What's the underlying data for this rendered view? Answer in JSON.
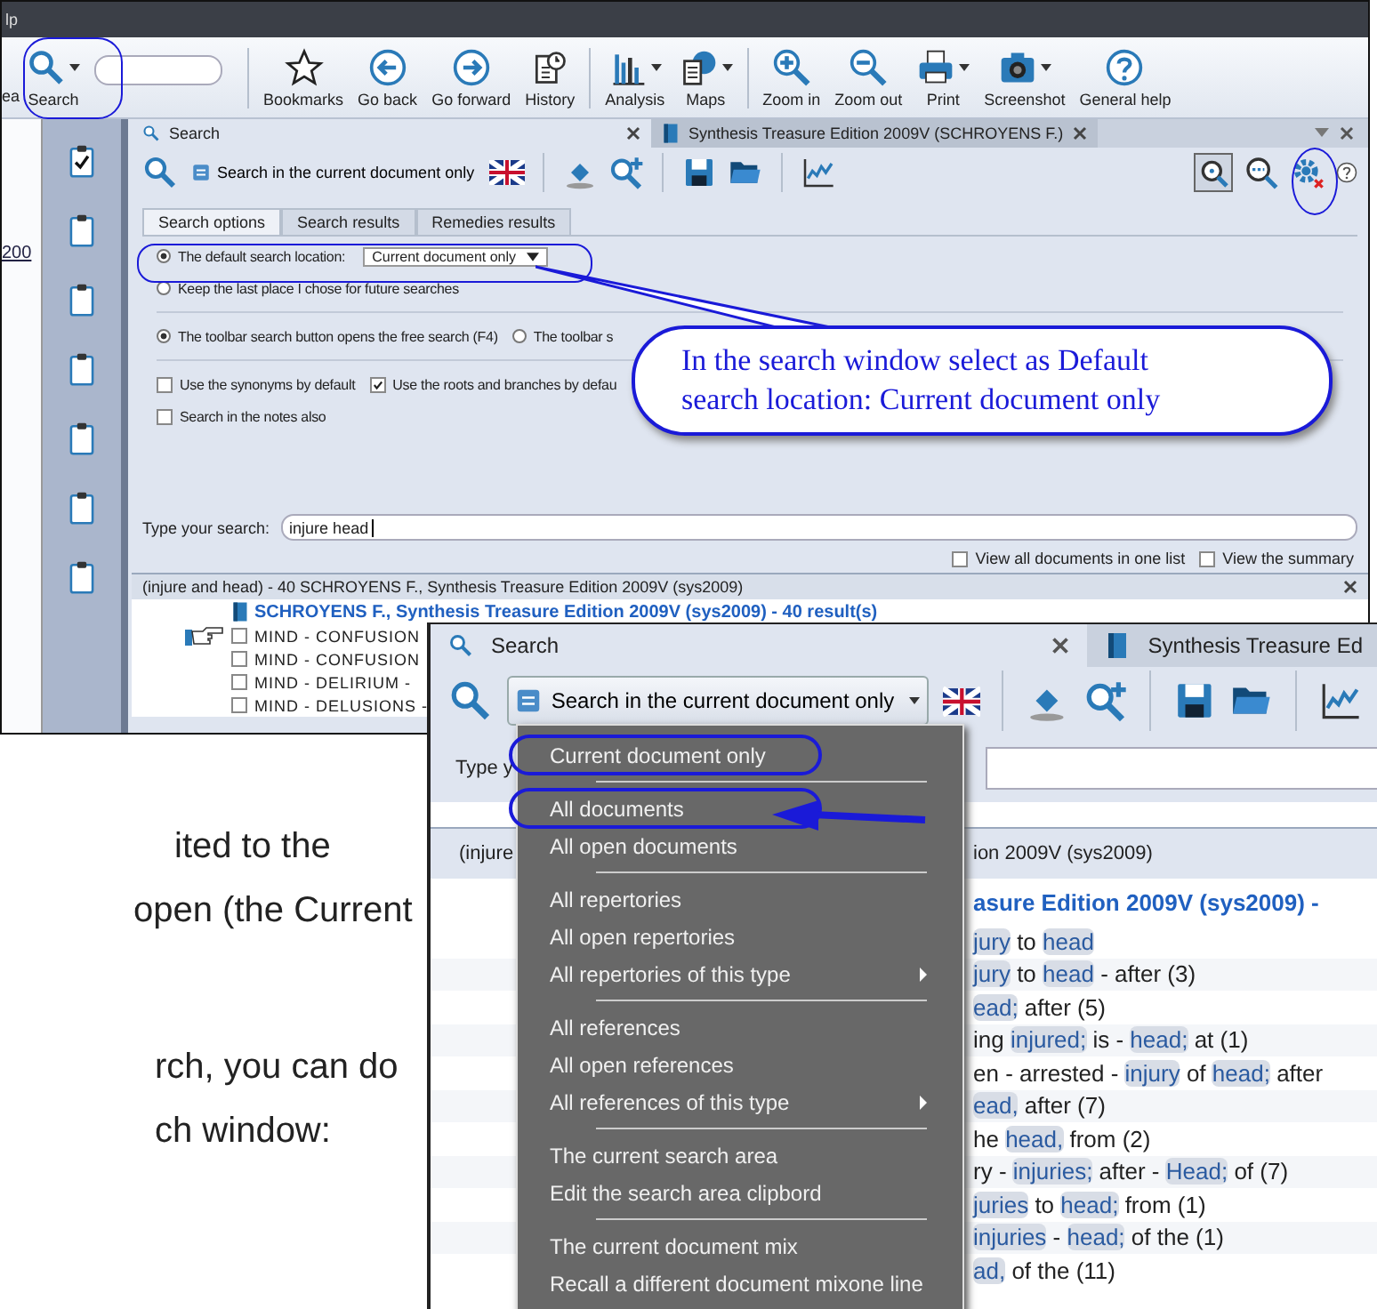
{
  "doc_text": [
    "ited to the",
    "open (the Current",
    "rch, you can do",
    "ch window:"
  ],
  "screen_1": {
    "title": "lp",
    "left_cut_label": "ea",
    "left_panel_text": "200",
    "toolbar": {
      "search": {
        "label": "Search",
        "dropdown": true
      },
      "groups": [
        [
          {
            "kind": "star",
            "label": "Bookmarks",
            "dropdown": false
          },
          {
            "kind": "back",
            "label": "Go back",
            "dropdown": false
          },
          {
            "kind": "forward",
            "label": "Go forward",
            "dropdown": false
          },
          {
            "kind": "history",
            "label": "History",
            "dropdown": false
          }
        ],
        [
          {
            "kind": "chart",
            "label": "Analysis",
            "dropdown": true
          },
          {
            "kind": "map",
            "label": "Maps",
            "dropdown": true
          }
        ],
        [
          {
            "kind": "zoomin",
            "label": "Zoom in",
            "dropdown": false
          },
          {
            "kind": "zoomout",
            "label": "Zoom out",
            "dropdown": false
          },
          {
            "kind": "print",
            "label": "Print",
            "dropdown": true
          },
          {
            "kind": "camera",
            "label": "Screenshot",
            "dropdown": true
          },
          {
            "kind": "help",
            "label": "General help",
            "dropdown": false
          }
        ]
      ]
    },
    "sidebar_icons": [
      {
        "checked": true
      },
      {
        "checked": false
      },
      {
        "checked": false
      },
      {
        "checked": false
      },
      {
        "checked": false
      },
      {
        "checked": false
      },
      {
        "checked": false
      }
    ],
    "panel_tabs": [
      {
        "label": "Search",
        "selected": true,
        "kind": "search"
      },
      {
        "label": "Synthesis Treasure Edition 2009V (SCHROYENS F.)",
        "selected": false,
        "kind": "book"
      }
    ],
    "location_button": "Search in the current document only",
    "option_tabs": [
      {
        "label": "Search options",
        "selected": true
      },
      {
        "label": "Search results",
        "selected": false
      },
      {
        "label": "Remedies results",
        "selected": false
      }
    ],
    "default_location": {
      "label": "The default search location:",
      "selected": true,
      "value": "Current document only"
    },
    "keep_last": {
      "label": "Keep the last place I chose for future searches",
      "selected": false
    },
    "toolbar_button_options": [
      {
        "label": "The toolbar search button opens the free search (F4)",
        "selected": true
      },
      {
        "label": "The toolbar s",
        "selected": false
      }
    ],
    "checkboxes": [
      {
        "label": "Use the synonyms by default",
        "checked": false
      },
      {
        "label": "Use the roots and branches by defau",
        "checked": true
      }
    ],
    "notes_checkbox": {
      "label": "Search in the notes also",
      "checked": false
    },
    "search_label": "Type your search:",
    "search_value": "injure head",
    "view_options": [
      {
        "label": "View all documents in one list",
        "checked": false
      },
      {
        "label": "View the summary",
        "checked": false
      }
    ],
    "results_header": "(injure and head) - 40   SCHROYENS F., Synthesis Treasure Edition 2009V (sys2009)",
    "results_title": "SCHROYENS F., Synthesis Treasure Edition 2009V (sys2009) - 40 result(s)",
    "results": [
      {
        "text": "MIND - CONFUSION",
        "pointer": true,
        "checked": false
      },
      {
        "text": "MIND - CONFUSION",
        "pointer": false,
        "checked": false
      },
      {
        "text": "MIND - DELIRIUM -",
        "pointer": false,
        "checked": false
      },
      {
        "text": "MIND - DELUSIONS -",
        "pointer": false,
        "checked": false
      }
    ]
  },
  "callout": [
    "In the search window select as Default",
    "search location:  Current document only"
  ],
  "screen_2": {
    "tabs": [
      {
        "label": "Search",
        "selected": true,
        "kind": "search"
      },
      {
        "label": "Synthesis Treasure Ed",
        "selected": false,
        "kind": "book"
      }
    ],
    "location_button": "Search in the current document only",
    "search_label": "Type y",
    "header_left": "(injure",
    "header_right": "ion 2009V (sys2009)",
    "results_title": "asure Edition 2009V (sys2009) -",
    "rows": [
      {
        "segments": [
          {
            "text": "jury",
            "match": true
          },
          {
            "text": " to ",
            "match": false
          },
          {
            "text": "head",
            "match": true
          }
        ]
      },
      {
        "segments": [
          {
            "text": "jury",
            "match": true
          },
          {
            "text": " to ",
            "match": false
          },
          {
            "text": "head",
            "match": true
          },
          {
            "text": " - after (3)",
            "match": false
          }
        ]
      },
      {
        "segments": [
          {
            "text": "ead;",
            "match": true
          },
          {
            "text": " after (5)",
            "match": false
          }
        ]
      },
      {
        "segments": [
          {
            "text": "ing ",
            "match": false
          },
          {
            "text": "injured;",
            "match": true
          },
          {
            "text": " is - ",
            "match": false
          },
          {
            "text": "head;",
            "match": true
          },
          {
            "text": " at (1)",
            "match": false
          }
        ]
      },
      {
        "segments": [
          {
            "text": "en - arrested - ",
            "match": false
          },
          {
            "text": "injury",
            "match": true
          },
          {
            "text": " of ",
            "match": false
          },
          {
            "text": "head;",
            "match": true
          },
          {
            "text": " after",
            "match": false
          }
        ]
      },
      {
        "segments": [
          {
            "text": "ead,",
            "match": true
          },
          {
            "text": " after (7)",
            "match": false
          }
        ]
      },
      {
        "segments": [
          {
            "text": "he ",
            "match": false
          },
          {
            "text": "head,",
            "match": true
          },
          {
            "text": " from (2)",
            "match": false
          }
        ]
      },
      {
        "segments": [
          {
            "text": "ry - ",
            "match": false
          },
          {
            "text": "injuries;",
            "match": true
          },
          {
            "text": " after - ",
            "match": false
          },
          {
            "text": "Head;",
            "match": true
          },
          {
            "text": " of (7)",
            "match": false
          }
        ]
      },
      {
        "segments": [
          {
            "text": "juries",
            "match": true
          },
          {
            "text": " to ",
            "match": false
          },
          {
            "text": "head;",
            "match": true
          },
          {
            "text": " from (1)",
            "match": false
          }
        ]
      },
      {
        "segments": [
          {
            "text": "injuries",
            "match": true
          },
          {
            "text": " - ",
            "match": false
          },
          {
            "text": "head;",
            "match": true
          },
          {
            "text": " of the (1)",
            "match": false
          }
        ]
      },
      {
        "segments": [
          {
            "text": "ad,",
            "match": true
          },
          {
            "text": " of the (11)",
            "match": false
          }
        ]
      }
    ],
    "menu": [
      [
        {
          "label": "Current document only",
          "submenu": false,
          "circled": true
        }
      ],
      [
        {
          "label": "All documents",
          "submenu": false,
          "circled": true
        },
        {
          "label": "All open documents",
          "submenu": false,
          "circled": false
        }
      ],
      [
        {
          "label": "All repertories",
          "submenu": false,
          "circled": false
        },
        {
          "label": "All open repertories",
          "submenu": false,
          "circled": false
        },
        {
          "label": "All repertories of this type",
          "submenu": true,
          "circled": false
        }
      ],
      [
        {
          "label": "All references",
          "submenu": false,
          "circled": false
        },
        {
          "label": "All open references",
          "submenu": false,
          "circled": false
        },
        {
          "label": "All references of this type",
          "submenu": true,
          "circled": false
        }
      ],
      [
        {
          "label": "The current search area",
          "submenu": false,
          "circled": false
        },
        {
          "label": "Edit the search area clipbord",
          "submenu": false,
          "circled": false
        }
      ],
      [
        {
          "label": "The current document mix",
          "submenu": false,
          "circled": false
        },
        {
          "label": "Recall a different document mixone line",
          "submenu": false,
          "circled": false
        }
      ]
    ]
  }
}
